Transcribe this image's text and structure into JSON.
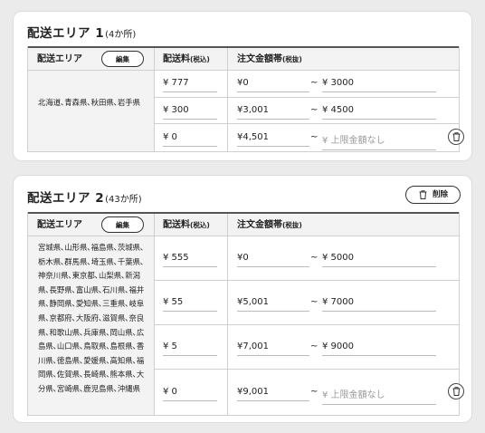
{
  "areas": [
    {
      "title": "配送エリア 1",
      "count": "(4か所)",
      "headers": {
        "area": "配送エリア",
        "edit": "編集",
        "fee": "配送料",
        "fee_sub": "(税込)",
        "amount": "注文金額帯",
        "amount_sub": "(税抜)"
      },
      "prefectures": "北海道､青森県､秋田県､岩手県",
      "rows": [
        {
          "fee": "¥ 777",
          "from": "¥0",
          "tilde": "~",
          "to": "¥ 3000"
        },
        {
          "fee": "¥ 300",
          "from": "¥3,001",
          "tilde": "~",
          "to": "¥ 4500"
        },
        {
          "fee": "¥ 0",
          "from": "¥4,501",
          "tilde": "~",
          "to_placeholder": "¥ 上限金額なし"
        }
      ]
    },
    {
      "title": "配送エリア 2",
      "count": "(43か所)",
      "delete_label": "削除",
      "headers": {
        "area": "配送エリア",
        "edit": "編集",
        "fee": "配送料",
        "fee_sub": "(税込)",
        "amount": "注文金額帯",
        "amount_sub": "(税抜)"
      },
      "prefectures": "宮城県､山形県､福島県､茨城県､栃木県､群馬県､埼玉県､千葉県､神奈川県､東京都､山梨県､新潟県､長野県､富山県､石川県､福井県､静岡県､愛知県､三重県､岐阜県､京都府､大阪府､滋賀県､奈良県､和歌山県､兵庫県､岡山県､広島県､山口県､鳥取県､島根県､香川県､徳島県､愛媛県､高知県､福岡県､佐賀県､長崎県､熊本県､大分県､宮崎県､鹿児島県､沖縄県",
      "rows": [
        {
          "fee": "¥ 555",
          "from": "¥0",
          "tilde": "~",
          "to": "¥ 5000"
        },
        {
          "fee": "¥ 55",
          "from": "¥5,001",
          "tilde": "~",
          "to": "¥ 7000"
        },
        {
          "fee": "¥ 5",
          "from": "¥7,001",
          "tilde": "~",
          "to": "¥ 9000"
        },
        {
          "fee": "¥ 0",
          "from": "¥9,001",
          "tilde": "~",
          "to_placeholder": "¥ 上限金額なし"
        }
      ]
    }
  ],
  "icons": {
    "row_delete": "trash-icon",
    "area_delete": "trash-icon"
  }
}
